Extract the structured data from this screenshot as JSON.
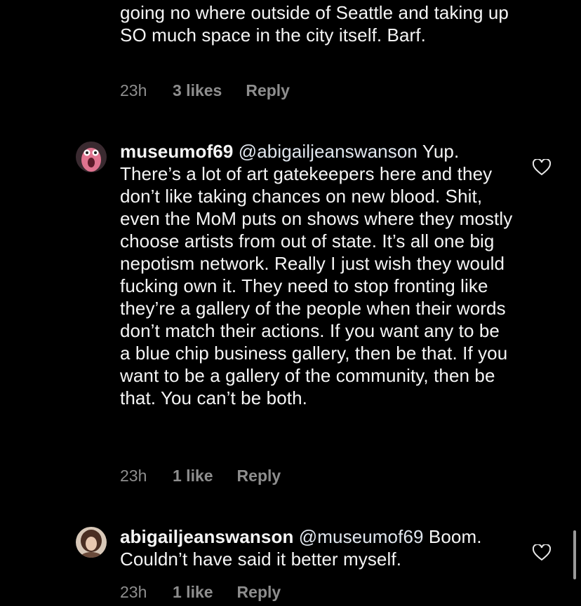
{
  "comments": [
    {
      "text": "going no where outside of Seattle and taking up SO much space in the city itself. Barf.",
      "timestamp": "23h",
      "likes": "3 likes",
      "reply_label": "Reply"
    },
    {
      "username": "museumof69",
      "mention": "@abigailjeanswanson",
      "text": " Yup. There’s a lot of art gatekeepers here and they don’t like taking chances on new blood. Shit, even the MoM puts on shows where they mostly choose artists from out of state. It’s all one big nepotism network. Really I just wish they would fucking own it. They need to stop fronting like they’re a gallery of the people when their words don’t match their actions. If you want any to be a blue chip business gallery, then be that. If you want to be a gallery of the community, then be that. You can’t be both.",
      "timestamp": "23h",
      "likes": "1 like",
      "reply_label": "Reply"
    },
    {
      "username": "abigailjeanswanson",
      "mention": "@museumof69",
      "text": " Boom. Couldn’t have said it better myself.",
      "timestamp": "23h",
      "likes": "1 like",
      "reply_label": "Reply"
    }
  ],
  "icons": {
    "like": "heart-outline-icon"
  },
  "colors": {
    "background": "#000000",
    "text": "#f5f5f5",
    "meta": "#8e8e8e",
    "avatar1": "#e0738f"
  }
}
